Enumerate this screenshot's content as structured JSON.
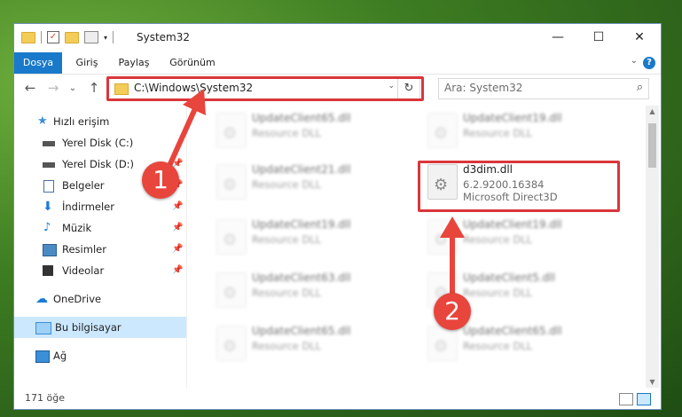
{
  "window": {
    "title": "System32"
  },
  "ribbon": {
    "tabs": [
      {
        "label": "Dosya",
        "active": true
      },
      {
        "label": "Giriş"
      },
      {
        "label": "Paylaş"
      },
      {
        "label": "Görünüm"
      }
    ],
    "help": "?"
  },
  "controls": {
    "minimize": "—",
    "maximize": "☐",
    "close": "✕"
  },
  "nav": {
    "back": "←",
    "forward": "→",
    "recent": "⌄",
    "up": "↑"
  },
  "address": {
    "path": "C:\\Windows\\System32",
    "dropdown": "⌄",
    "refresh": "↻"
  },
  "search": {
    "placeholder": "Ara: System32",
    "icon": "⌕"
  },
  "sidebar": {
    "items": [
      {
        "label": "Hızlı erişim",
        "icon": "star-icon",
        "color": "#3a8fd8"
      },
      {
        "label": "Yerel Disk (C:)",
        "icon": "drive-icon",
        "color": "#555555"
      },
      {
        "label": "Yerel Disk (D:)",
        "icon": "drive-icon",
        "color": "#555555"
      },
      {
        "label": "Belgeler",
        "icon": "document-icon",
        "color": "#4a6fa5"
      },
      {
        "label": "İndirmeler",
        "icon": "download-icon",
        "color": "#1c7bd4"
      },
      {
        "label": "Müzik",
        "icon": "music-icon",
        "color": "#1c7bd4"
      },
      {
        "label": "Resimler",
        "icon": "picture-icon",
        "color": "#4a8bc4"
      },
      {
        "label": "Videolar",
        "icon": "video-icon",
        "color": "#333333"
      },
      {
        "label": "OneDrive",
        "icon": "cloud-icon",
        "color": "#1c7bd4"
      },
      {
        "label": "Bu bilgisayar",
        "icon": "computer-icon",
        "color": "#3a8fd8"
      },
      {
        "label": "Ağ",
        "icon": "network-icon",
        "color": "#3a8fd8"
      }
    ]
  },
  "files": [
    {
      "name": "UpdateClient65.dll",
      "type": "Resource DLL"
    },
    {
      "name": "UpdateClient19.dll",
      "type": "Resource DLL"
    },
    {
      "name": "UpdateClient21.dll",
      "type": "Resource DLL"
    },
    {
      "name": "d3dim.dll",
      "version": "6.2.9200.16384",
      "type": "Microsoft Direct3D"
    },
    {
      "name": "UpdateClient19.dll",
      "type": "Resource DLL"
    },
    {
      "name": "UpdateClient19.dll",
      "type": "Resource DLL"
    },
    {
      "name": "UpdateClient63.dll",
      "type": "Resource DLL"
    },
    {
      "name": "UpdateClient5.dll",
      "type": "Resource DLL"
    },
    {
      "name": "UpdateClient65.dll",
      "type": "Resource DLL"
    },
    {
      "name": "UpdateClient65.dll",
      "type": "Resource DLL"
    }
  ],
  "status": {
    "count": "171 öğe"
  },
  "annotations": {
    "badge1": "1",
    "badge2": "2",
    "color": "#e8453c"
  }
}
